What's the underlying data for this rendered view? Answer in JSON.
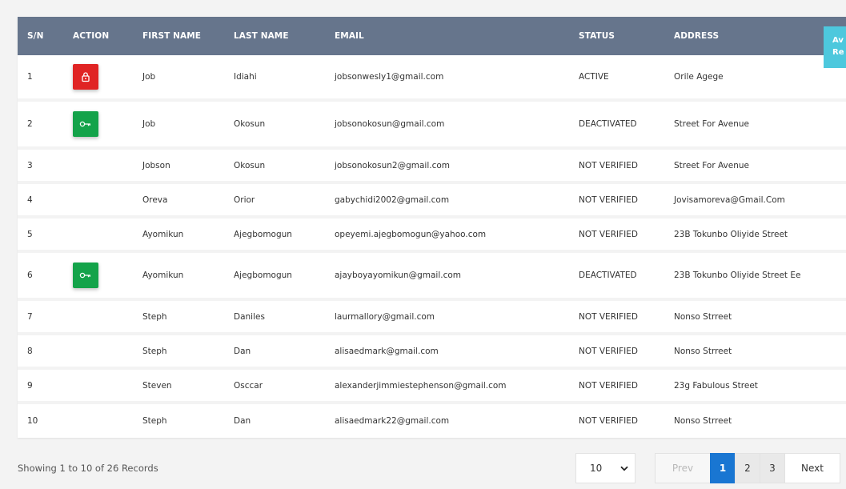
{
  "table": {
    "headers": [
      "S/N",
      "ACTION",
      "FIRST NAME",
      "LAST NAME",
      "EMAIL",
      "STATUS",
      "ADDRESS"
    ],
    "rows": [
      {
        "sn": "1",
        "action": "lock-icon",
        "first": "Job",
        "last": "Idiahi",
        "email": "jobsonwesly1@gmail.com",
        "status": "ACTIVE",
        "address": "Orile Agege"
      },
      {
        "sn": "2",
        "action": "key-icon",
        "first": "Job",
        "last": "Okosun",
        "email": "jobsonokosun@gmail.com",
        "status": "DEACTIVATED",
        "address": "Street For Avenue"
      },
      {
        "sn": "3",
        "action": "",
        "first": "Jobson",
        "last": "Okosun",
        "email": "jobsonokosun2@gmail.com",
        "status": "NOT VERIFIED",
        "address": "Street For Avenue"
      },
      {
        "sn": "4",
        "action": "",
        "first": "Oreva",
        "last": "Orior",
        "email": "gabychidi2002@gmail.com",
        "status": "NOT VERIFIED",
        "address": "Jovisamoreva@Gmail.Com"
      },
      {
        "sn": "5",
        "action": "",
        "first": "Ayomikun",
        "last": "Ajegbomogun",
        "email": "opeyemi.ajegbomogun@yahoo.com",
        "status": "NOT VERIFIED",
        "address": "23B Tokunbo Oliyide Street"
      },
      {
        "sn": "6",
        "action": "key-icon",
        "first": "Ayomikun",
        "last": "Ajegbomogun",
        "email": "ajayboyayomikun@gmail.com",
        "status": "DEACTIVATED",
        "address": "23B Tokunbo Oliyide Street Ee"
      },
      {
        "sn": "7",
        "action": "",
        "first": "Steph",
        "last": "Daniles",
        "email": "laurmallory@gmail.com",
        "status": "NOT VERIFIED",
        "address": "Nonso Strreet"
      },
      {
        "sn": "8",
        "action": "",
        "first": "Steph",
        "last": "Dan",
        "email": "alisaedmark@gmail.com",
        "status": "NOT VERIFIED",
        "address": "Nonso Strreet"
      },
      {
        "sn": "9",
        "action": "",
        "first": "Steven",
        "last": "Osccar",
        "email": "alexanderjimmiestephenson@gmail.com",
        "status": "NOT VERIFIED",
        "address": "23g Fabulous Street"
      },
      {
        "sn": "10",
        "action": "",
        "first": "Steph",
        "last": "Dan",
        "email": "alisaedmark22@gmail.com",
        "status": "NOT VERIFIED",
        "address": "Nonso Strreet"
      }
    ]
  },
  "side_tab": {
    "line1": "Av",
    "line2": "Re"
  },
  "footer": {
    "records_text": "Showing 1 to 10 of 26 Records",
    "page_size": "10",
    "prev_label": "Prev",
    "pages": [
      "1",
      "2",
      "3"
    ],
    "active_page": "1",
    "next_label": "Next"
  },
  "colors": {
    "header_bg": "#66758c",
    "lock_button": "#e02424",
    "key_button": "#14a34a",
    "active_page": "#1976d2",
    "side_tab": "#4dc8dd"
  }
}
